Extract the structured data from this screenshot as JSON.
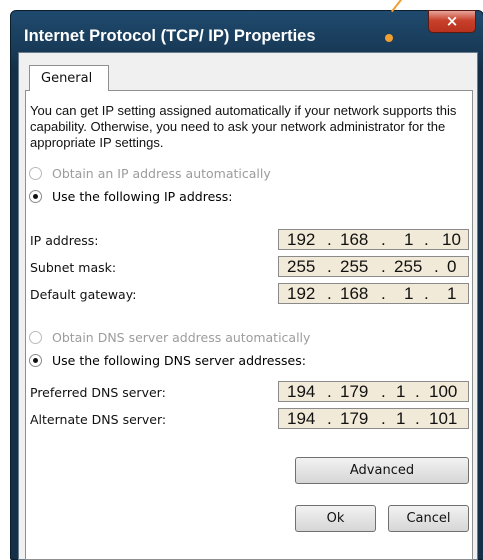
{
  "window": {
    "title": "Internet Protocol (TCP/ IP) Properties",
    "close_glyph": "×"
  },
  "tabs": [
    {
      "label": "General"
    }
  ],
  "description": "You can get IP setting assigned automatically if your network supports this capability.  Otherwise, you need to ask your network administrator for the appropriate IP settings.",
  "ip_mode": {
    "auto_label": "Obtain an IP address automatically",
    "manual_label": "Use the following IP address:",
    "selected": "manual"
  },
  "fields": {
    "ip_address": {
      "label": "IP address:",
      "octets": [
        "192",
        "168",
        "1",
        "10"
      ]
    },
    "subnet_mask": {
      "label": "Subnet mask:",
      "octets": [
        "255",
        "255",
        "255",
        "0"
      ]
    },
    "default_gateway": {
      "label": "Default gateway:",
      "octets": [
        "192",
        "168",
        "1",
        "1"
      ]
    }
  },
  "dns_mode": {
    "auto_label": "Obtain DNS server address automatically",
    "manual_label": "Use the following DNS server addresses:",
    "selected": "manual"
  },
  "dns": {
    "preferred": {
      "label": "Preferred DNS server:",
      "octets": [
        "194",
        "179",
        "1",
        "100"
      ]
    },
    "alternate": {
      "label": "Alternate DNS server:",
      "octets": [
        "194",
        "179",
        "1",
        "101"
      ]
    }
  },
  "buttons": {
    "advanced": "Advanced",
    "ok": "Ok",
    "cancel": "Cancel"
  },
  "colors": {
    "titlebar": "#1f4a6e",
    "close_button": "#c8402b",
    "ip_field_bg": "#f2ead8",
    "annotation": "#f0a030"
  }
}
